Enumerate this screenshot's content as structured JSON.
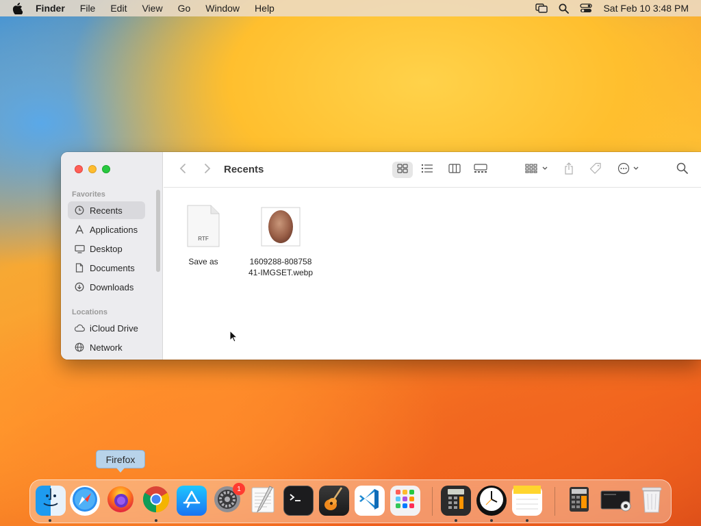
{
  "menubar": {
    "app_name": "Finder",
    "items": [
      "File",
      "Edit",
      "View",
      "Go",
      "Window",
      "Help"
    ],
    "clock": "Sat Feb 10  3:48 PM",
    "icons": [
      "apple-icon",
      "screen-mirroring-icon",
      "spotlight-icon",
      "control-center-icon"
    ]
  },
  "finder": {
    "title": "Recents",
    "sidebar": {
      "favorites_label": "Favorites",
      "favorites": [
        {
          "label": "Recents",
          "icon": "clock-icon",
          "selected": true
        },
        {
          "label": "Applications",
          "icon": "applications-icon"
        },
        {
          "label": "Desktop",
          "icon": "desktop-icon"
        },
        {
          "label": "Documents",
          "icon": "document-icon"
        },
        {
          "label": "Downloads",
          "icon": "download-icon"
        }
      ],
      "locations_label": "Locations",
      "locations": [
        {
          "label": "iCloud Drive",
          "icon": "cloud-icon"
        },
        {
          "label": "Network",
          "icon": "network-icon"
        }
      ]
    },
    "files": [
      {
        "name": "Save as",
        "type_badge": "RTF"
      },
      {
        "name_line1": "1609288-808758",
        "name_line2": "41-IMGSET.webp"
      }
    ]
  },
  "tooltip": "Firefox",
  "dock": {
    "apps": [
      "Finder",
      "Safari",
      "Firefox",
      "Chrome",
      "App Store",
      "System Settings",
      "TextEdit",
      "Terminal",
      "GarageBand",
      "Visual Studio Code",
      "Launchpad",
      "Calculator",
      "Clock",
      "Notes",
      "Calculator Document",
      "Screenshot",
      "Trash"
    ],
    "settings_badge": "1"
  }
}
